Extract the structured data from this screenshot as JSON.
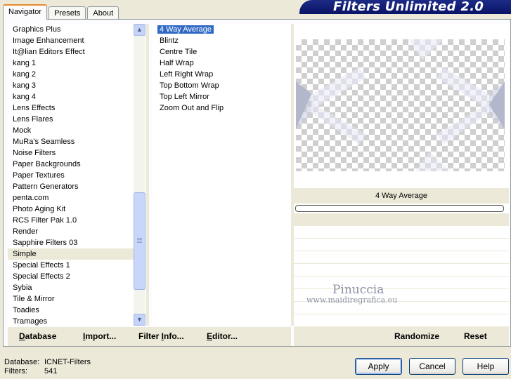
{
  "app": {
    "title": "Filters Unlimited 2.0"
  },
  "tabs": [
    {
      "label": "Navigator",
      "active": true
    },
    {
      "label": "Presets",
      "active": false
    },
    {
      "label": "About",
      "active": false
    }
  ],
  "categories": {
    "items": [
      "Graphics Plus",
      "Image Enhancement",
      "It@lian Editors Effect",
      "kang 1",
      "kang 2",
      "kang 3",
      "kang 4",
      "Lens Effects",
      "Lens Flares",
      "Mock",
      "MuRa's Seamless",
      "Noise Filters",
      "Paper Backgrounds",
      "Paper Textures",
      "Pattern Generators",
      "penta.com",
      "Photo Aging Kit",
      "RCS Filter Pak 1.0",
      "Render",
      "Sapphire Filters 03",
      "Simple",
      "Special Effects 1",
      "Special Effects 2",
      "Sybia",
      "Tile & Mirror",
      "Toadies",
      "Tramages"
    ],
    "selected": "Simple"
  },
  "filters": {
    "items": [
      "4 Way Average",
      "Blintz",
      "Centre Tile",
      "Half Wrap",
      "Left Right Wrap",
      "Top Bottom Wrap",
      "Top Left Mirror",
      "Zoom Out and Flip"
    ],
    "selected": "4 Way Average"
  },
  "preview": {
    "filter_name": "4 Way Average",
    "progress": 0,
    "watermark_name": "Pinuccia",
    "watermark_url": "www.maidiregrafica.eu"
  },
  "actions_left": [
    {
      "label": "Database",
      "underline": "D",
      "rest": "atabase"
    },
    {
      "label": "Import...",
      "pre": "",
      "underline": "I",
      "rest": "mport..."
    },
    {
      "label": "Filter Info...",
      "pre": "Filter ",
      "underline": "I",
      "rest": "nfo..."
    },
    {
      "label": "Editor...",
      "pre": "",
      "underline": "E",
      "rest": "ditor..."
    }
  ],
  "actions_right": {
    "randomize": "Randomize",
    "reset": "Reset"
  },
  "info": {
    "database_label": "Database:",
    "database_value": "ICNET-Filters",
    "filters_label": "Filters:",
    "filters_value": "541"
  },
  "buttons": {
    "apply": "Apply",
    "cancel": "Cancel",
    "help": "Help"
  },
  "colors": {
    "banner": "#0a1466",
    "selection": "#316ac5",
    "tab_accent": "#e68b2c"
  },
  "icons": {
    "scroll_up": "chevron-up-icon",
    "scroll_down": "chevron-down-icon"
  }
}
